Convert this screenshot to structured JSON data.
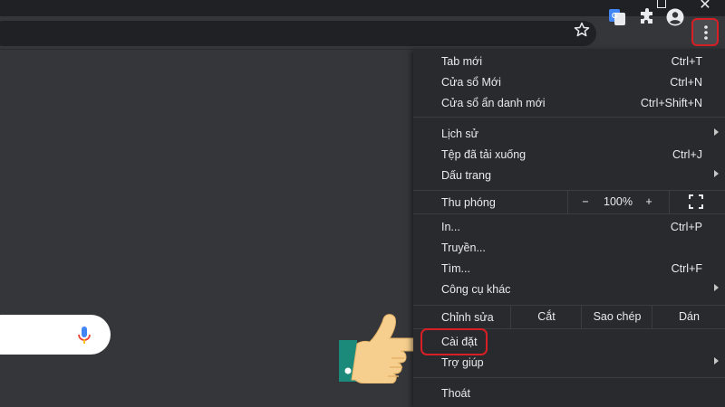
{
  "window": {
    "restore_icon": "restore-icon",
    "close_glyph": "✕"
  },
  "toolbar": {
    "bookmark_icon": "star-icon",
    "translate_icon": "google-translate-icon",
    "extensions_icon": "puzzle-icon",
    "profile_icon": "account-circle-icon",
    "menu_icon": "vertical-dots-icon"
  },
  "search": {
    "mic_icon": "microphone-icon"
  },
  "menu": {
    "new_tab": {
      "label": "Tab mới",
      "shortcut": "Ctrl+T"
    },
    "new_window": {
      "label": "Cửa sổ Mới",
      "shortcut": "Ctrl+N"
    },
    "incognito": {
      "label": "Cửa sổ ẩn danh mới",
      "shortcut": "Ctrl+Shift+N"
    },
    "history": {
      "label": "Lịch sử"
    },
    "downloads": {
      "label": "Tệp đã tải xuống",
      "shortcut": "Ctrl+J"
    },
    "bookmarks": {
      "label": "Dấu trang"
    },
    "zoom": {
      "label": "Thu phóng",
      "minus": "−",
      "value": "100%",
      "plus": "+"
    },
    "print": {
      "label": "In...",
      "shortcut": "Ctrl+P"
    },
    "cast": {
      "label": "Truyền..."
    },
    "find": {
      "label": "Tìm...",
      "shortcut": "Ctrl+F"
    },
    "more_tools": {
      "label": "Công cụ khác"
    },
    "edit": {
      "label": "Chỉnh sửa",
      "cut": "Cắt",
      "copy": "Sao chép",
      "paste": "Dán"
    },
    "settings": {
      "label": "Cài đặt"
    },
    "help": {
      "label": "Trợ giúp"
    },
    "exit": {
      "label": "Thoát"
    }
  },
  "colors": {
    "menu_bg": "#292a2d",
    "page_bg": "#35363a",
    "highlight": "#d81f26"
  }
}
